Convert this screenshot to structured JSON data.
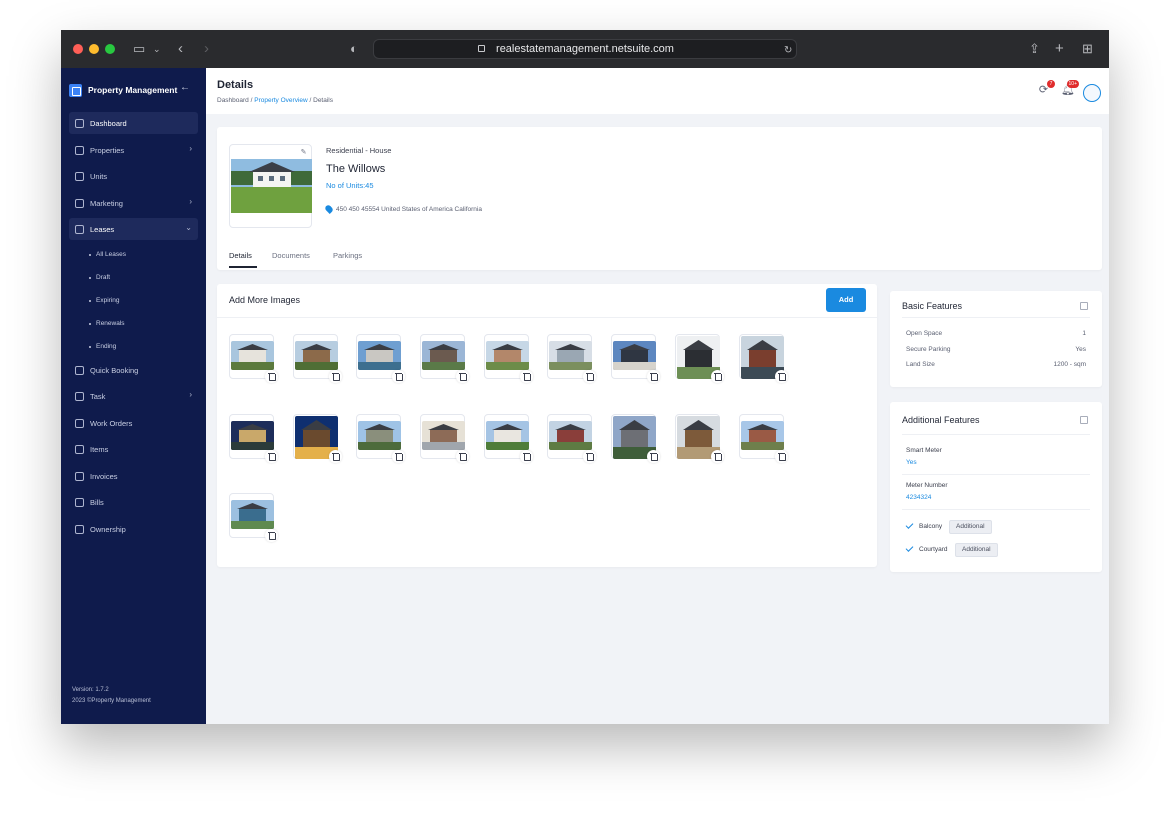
{
  "browser": {
    "url": "realestatemanagement.netsuite.com"
  },
  "sidebar": {
    "brand": "Property Management",
    "items": [
      {
        "label": "Dashboard",
        "icon": "grid-icon"
      },
      {
        "label": "Properties",
        "icon": "building-icon"
      },
      {
        "label": "Units",
        "icon": "units-grid-icon"
      },
      {
        "label": "Marketing",
        "icon": "megaphone-icon"
      },
      {
        "label": "Leases",
        "icon": "document-icon"
      },
      {
        "label": "Quick Booking",
        "icon": "hand-icon"
      },
      {
        "label": "Task",
        "icon": "clipboard-icon"
      },
      {
        "label": "Work Orders",
        "icon": "layers-icon"
      },
      {
        "label": "Items",
        "icon": "list-icon"
      },
      {
        "label": "Invoices",
        "icon": "invoice-icon"
      },
      {
        "label": "Bills",
        "icon": "bill-icon"
      },
      {
        "label": "Ownership",
        "icon": "handshake-icon"
      }
    ],
    "lease_sub": [
      "All Leases",
      "Draft",
      "Expiring",
      "Renewals",
      "Ending"
    ],
    "version": "Version: 1.7.2",
    "copyright": "2023 ©Property Management"
  },
  "header": {
    "title": "Details",
    "breadcrumb": {
      "home": "Dashboard",
      "sep1": " / ",
      "overview": "Property Overview",
      "sep2": " / ",
      "current": "Details"
    },
    "sync_badge": "7",
    "notif_badge": "10+"
  },
  "property": {
    "type": "Residential -  House",
    "name": "The Willows",
    "units": "No of Units:45",
    "address": "450 450 45554 United States of America California",
    "tabs": [
      "Details",
      "Documents",
      "Parkings"
    ]
  },
  "images": {
    "title": "Add More Images",
    "add_label": "Add",
    "count": 19
  },
  "basic_features": {
    "title": "Basic Features",
    "rows": [
      {
        "label": "Open Space",
        "value": "1"
      },
      {
        "label": "Secure Parking",
        "value": "Yes"
      },
      {
        "label": "Land Size",
        "value": "1200 - sqm"
      }
    ]
  },
  "additional_features": {
    "title": "Additional Features",
    "smart_meter_label": "Smart Meter",
    "smart_meter_value": "Yes",
    "meter_number_label": "Meter Number",
    "meter_number_value": "4234324",
    "checks": [
      {
        "label": "Balcony",
        "tag": "Additional"
      },
      {
        "label": "Courtyard",
        "tag": "Additional"
      }
    ]
  },
  "colors": {
    "sidebar": "#0f1b4c",
    "accent": "#1a8ae0",
    "background": "#f1f3f7"
  }
}
